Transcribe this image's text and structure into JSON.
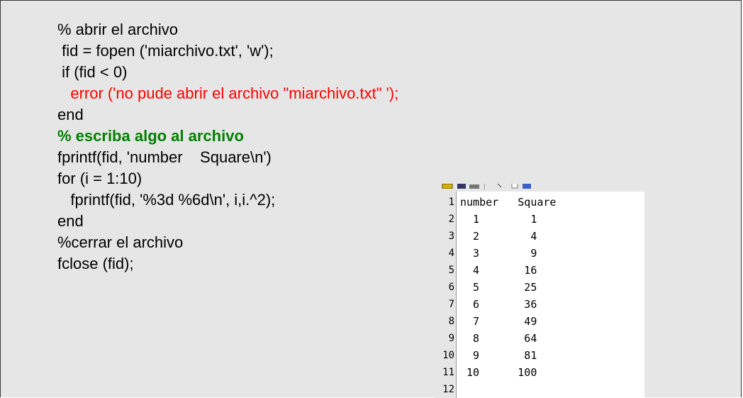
{
  "code": {
    "lines": [
      {
        "text": "% abrir el archivo",
        "style": "normal"
      },
      {
        "text": " fid = fopen ('miarchivo.txt', 'w');",
        "style": "normal"
      },
      {
        "text": " if (fid < 0)",
        "style": "normal"
      },
      {
        "text": "   error ('no pude abrir el archivo \"miarchivo.txt\" ');",
        "style": "red"
      },
      {
        "text": "end",
        "style": "normal"
      },
      {
        "text": "% escriba algo al archivo",
        "style": "green"
      },
      {
        "text": "fprintf(fid, 'number    Square\\n')",
        "style": "normal"
      },
      {
        "text": "for (i = 1:10)",
        "style": "normal"
      },
      {
        "text": "   fprintf(fid, '%3d %6d\\n', i,i.^2);",
        "style": "normal"
      },
      {
        "text": "end",
        "style": "normal"
      },
      {
        "text": "%cerrar el archivo",
        "style": "normal"
      },
      {
        "text": "fclose (fid);",
        "style": "normal"
      }
    ]
  },
  "editor": {
    "toolbar_icons": [
      "folder-icon",
      "save-icon",
      "print-icon",
      "cut-icon",
      "copy-icon",
      "paste-icon"
    ],
    "line_numbers": [
      "1",
      "2",
      "3",
      "4",
      "5",
      "6",
      "7",
      "8",
      "9",
      "10",
      "11",
      "12"
    ],
    "file_lines": [
      "number   Square",
      "  1        1",
      "  2        4",
      "  3        9",
      "  4       16",
      "  5       25",
      "  6       36",
      "  7       49",
      "  8       64",
      "  9       81",
      " 10      100",
      ""
    ]
  }
}
